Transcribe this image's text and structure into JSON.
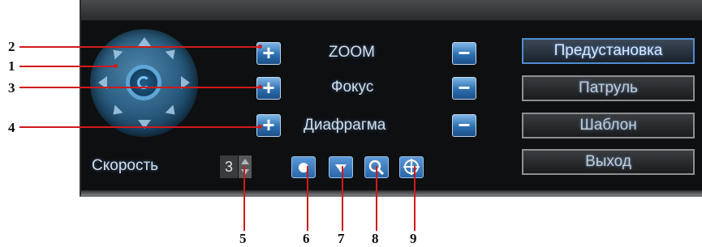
{
  "controls": {
    "zoom_label": "ZOOM",
    "focus_label": "Фокус",
    "iris_label": "Диафрагма",
    "plus": "+",
    "minus": "−",
    "speed_label": "Скорость",
    "speed_value": "3"
  },
  "menu": {
    "preset": "Предустановка",
    "patrol": "Патруль",
    "pattern": "Шаблон",
    "exit": "Выход"
  },
  "callouts": [
    "1",
    "2",
    "3",
    "4",
    "5",
    "6",
    "7",
    "8",
    "9"
  ],
  "icons": {
    "joystick": "ptz-joystick",
    "btn6": "record-dot-icon",
    "btn7": "triangle-icon",
    "btn8": "magnifier-icon",
    "btn9": "crosshair-icon"
  },
  "colors": {
    "panel_bg": "#0e0f10",
    "button_blue": "#2c6fb0",
    "callout_red": "#d01a1a"
  }
}
